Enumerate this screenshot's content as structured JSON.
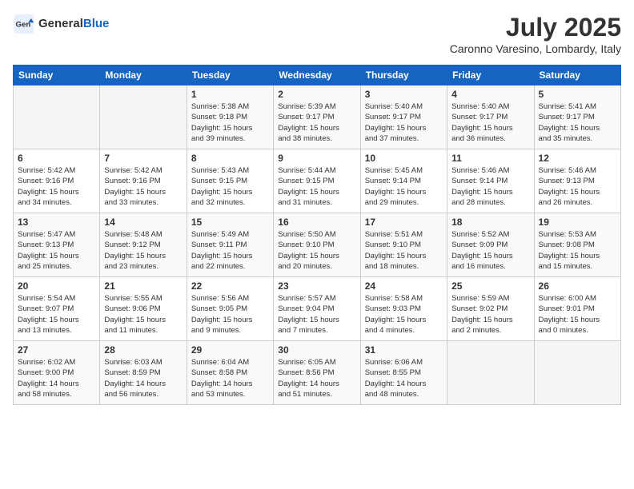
{
  "header": {
    "logo_general": "General",
    "logo_blue": "Blue",
    "month_title": "July 2025",
    "location": "Caronno Varesino, Lombardy, Italy"
  },
  "days_of_week": [
    "Sunday",
    "Monday",
    "Tuesday",
    "Wednesday",
    "Thursday",
    "Friday",
    "Saturday"
  ],
  "weeks": [
    [
      {
        "day": "",
        "info": ""
      },
      {
        "day": "",
        "info": ""
      },
      {
        "day": "1",
        "info": "Sunrise: 5:38 AM\nSunset: 9:18 PM\nDaylight: 15 hours\nand 39 minutes."
      },
      {
        "day": "2",
        "info": "Sunrise: 5:39 AM\nSunset: 9:17 PM\nDaylight: 15 hours\nand 38 minutes."
      },
      {
        "day": "3",
        "info": "Sunrise: 5:40 AM\nSunset: 9:17 PM\nDaylight: 15 hours\nand 37 minutes."
      },
      {
        "day": "4",
        "info": "Sunrise: 5:40 AM\nSunset: 9:17 PM\nDaylight: 15 hours\nand 36 minutes."
      },
      {
        "day": "5",
        "info": "Sunrise: 5:41 AM\nSunset: 9:17 PM\nDaylight: 15 hours\nand 35 minutes."
      }
    ],
    [
      {
        "day": "6",
        "info": "Sunrise: 5:42 AM\nSunset: 9:16 PM\nDaylight: 15 hours\nand 34 minutes."
      },
      {
        "day": "7",
        "info": "Sunrise: 5:42 AM\nSunset: 9:16 PM\nDaylight: 15 hours\nand 33 minutes."
      },
      {
        "day": "8",
        "info": "Sunrise: 5:43 AM\nSunset: 9:15 PM\nDaylight: 15 hours\nand 32 minutes."
      },
      {
        "day": "9",
        "info": "Sunrise: 5:44 AM\nSunset: 9:15 PM\nDaylight: 15 hours\nand 31 minutes."
      },
      {
        "day": "10",
        "info": "Sunrise: 5:45 AM\nSunset: 9:14 PM\nDaylight: 15 hours\nand 29 minutes."
      },
      {
        "day": "11",
        "info": "Sunrise: 5:46 AM\nSunset: 9:14 PM\nDaylight: 15 hours\nand 28 minutes."
      },
      {
        "day": "12",
        "info": "Sunrise: 5:46 AM\nSunset: 9:13 PM\nDaylight: 15 hours\nand 26 minutes."
      }
    ],
    [
      {
        "day": "13",
        "info": "Sunrise: 5:47 AM\nSunset: 9:13 PM\nDaylight: 15 hours\nand 25 minutes."
      },
      {
        "day": "14",
        "info": "Sunrise: 5:48 AM\nSunset: 9:12 PM\nDaylight: 15 hours\nand 23 minutes."
      },
      {
        "day": "15",
        "info": "Sunrise: 5:49 AM\nSunset: 9:11 PM\nDaylight: 15 hours\nand 22 minutes."
      },
      {
        "day": "16",
        "info": "Sunrise: 5:50 AM\nSunset: 9:10 PM\nDaylight: 15 hours\nand 20 minutes."
      },
      {
        "day": "17",
        "info": "Sunrise: 5:51 AM\nSunset: 9:10 PM\nDaylight: 15 hours\nand 18 minutes."
      },
      {
        "day": "18",
        "info": "Sunrise: 5:52 AM\nSunset: 9:09 PM\nDaylight: 15 hours\nand 16 minutes."
      },
      {
        "day": "19",
        "info": "Sunrise: 5:53 AM\nSunset: 9:08 PM\nDaylight: 15 hours\nand 15 minutes."
      }
    ],
    [
      {
        "day": "20",
        "info": "Sunrise: 5:54 AM\nSunset: 9:07 PM\nDaylight: 15 hours\nand 13 minutes."
      },
      {
        "day": "21",
        "info": "Sunrise: 5:55 AM\nSunset: 9:06 PM\nDaylight: 15 hours\nand 11 minutes."
      },
      {
        "day": "22",
        "info": "Sunrise: 5:56 AM\nSunset: 9:05 PM\nDaylight: 15 hours\nand 9 minutes."
      },
      {
        "day": "23",
        "info": "Sunrise: 5:57 AM\nSunset: 9:04 PM\nDaylight: 15 hours\nand 7 minutes."
      },
      {
        "day": "24",
        "info": "Sunrise: 5:58 AM\nSunset: 9:03 PM\nDaylight: 15 hours\nand 4 minutes."
      },
      {
        "day": "25",
        "info": "Sunrise: 5:59 AM\nSunset: 9:02 PM\nDaylight: 15 hours\nand 2 minutes."
      },
      {
        "day": "26",
        "info": "Sunrise: 6:00 AM\nSunset: 9:01 PM\nDaylight: 15 hours\nand 0 minutes."
      }
    ],
    [
      {
        "day": "27",
        "info": "Sunrise: 6:02 AM\nSunset: 9:00 PM\nDaylight: 14 hours\nand 58 minutes."
      },
      {
        "day": "28",
        "info": "Sunrise: 6:03 AM\nSunset: 8:59 PM\nDaylight: 14 hours\nand 56 minutes."
      },
      {
        "day": "29",
        "info": "Sunrise: 6:04 AM\nSunset: 8:58 PM\nDaylight: 14 hours\nand 53 minutes."
      },
      {
        "day": "30",
        "info": "Sunrise: 6:05 AM\nSunset: 8:56 PM\nDaylight: 14 hours\nand 51 minutes."
      },
      {
        "day": "31",
        "info": "Sunrise: 6:06 AM\nSunset: 8:55 PM\nDaylight: 14 hours\nand 48 minutes."
      },
      {
        "day": "",
        "info": ""
      },
      {
        "day": "",
        "info": ""
      }
    ]
  ]
}
